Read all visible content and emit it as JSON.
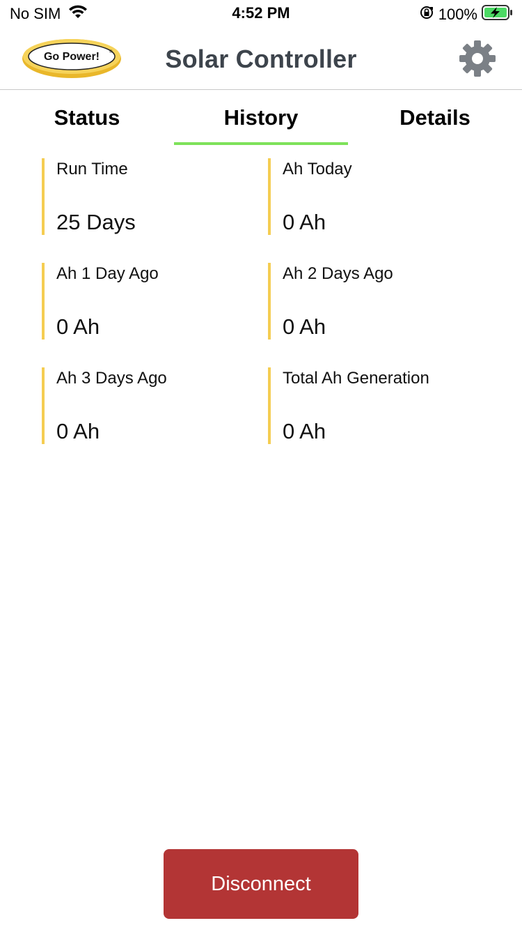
{
  "status_bar": {
    "carrier": "No SIM",
    "time": "4:52 PM",
    "battery_percent": "100%",
    "icons": [
      "wifi-icon",
      "orientation-lock-icon",
      "battery-charging-icon"
    ]
  },
  "header": {
    "logo_text": "Go Power!",
    "title": "Solar Controller",
    "settings_icon": "gear-icon"
  },
  "tabs": [
    {
      "label": "Status",
      "active": false
    },
    {
      "label": "History",
      "active": true
    },
    {
      "label": "Details",
      "active": false
    }
  ],
  "stats": [
    {
      "label": "Run Time",
      "value": "25 Days"
    },
    {
      "label": "Ah Today",
      "value": "0 Ah"
    },
    {
      "label": "Ah 1 Day Ago",
      "value": "0 Ah"
    },
    {
      "label": "Ah 2 Days Ago",
      "value": "0 Ah"
    },
    {
      "label": "Ah 3 Days Ago",
      "value": "0 Ah"
    },
    {
      "label": "Total Ah Generation",
      "value": "0 Ah"
    }
  ],
  "footer": {
    "disconnect_label": "Disconnect"
  },
  "colors": {
    "accent_tab": "#7ee25a",
    "stat_bar": "#f5cd52",
    "disconnect_bg": "#b33535",
    "title_text": "#3d444c",
    "battery_green": "#4cd964",
    "logo_gold": "#f2c230"
  }
}
